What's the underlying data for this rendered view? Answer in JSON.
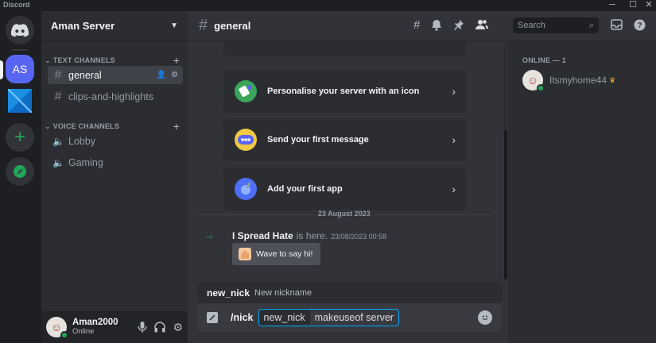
{
  "app": {
    "title": "Discord"
  },
  "window": {
    "minimize": "─",
    "maximize": "☐",
    "close": "✕"
  },
  "servers": {
    "active_initials": "AS"
  },
  "guild": {
    "name": "Aman Server"
  },
  "categories": {
    "text": "TEXT CHANNELS",
    "voice": "VOICE CHANNELS"
  },
  "channels": {
    "text": [
      {
        "name": "general"
      },
      {
        "name": "clips-and-highlights"
      }
    ],
    "voice": [
      {
        "name": "Lobby"
      },
      {
        "name": "Gaming"
      }
    ]
  },
  "header": {
    "channel": "general",
    "search_placeholder": "Search"
  },
  "cards": [
    {
      "label": "Personalise your server with an icon",
      "icon": "upload-icon"
    },
    {
      "label": "Send your first message",
      "icon": "message-icon"
    },
    {
      "label": "Add your first app",
      "icon": "app-icon"
    }
  ],
  "divider_date": "23 August 2023",
  "join": {
    "user": "I Spread Hate",
    "text": "is here.",
    "timestamp": "23/08/2023 00:58",
    "wave_label": "Wave to say hi!"
  },
  "command": {
    "option_name": "new_nick",
    "option_desc": "New nickname",
    "slash": "/nick",
    "chip_name": "new_nick",
    "chip_value": "makeuseof server"
  },
  "user": {
    "name": "Aman2000",
    "status": "Online"
  },
  "members": {
    "section": "ONLINE — 1",
    "list": [
      {
        "name": "Itsmyhome44",
        "owner": true
      }
    ]
  },
  "colors": {
    "accent": "#5865f2",
    "online": "#23a55a",
    "crown": "#f0b232"
  }
}
